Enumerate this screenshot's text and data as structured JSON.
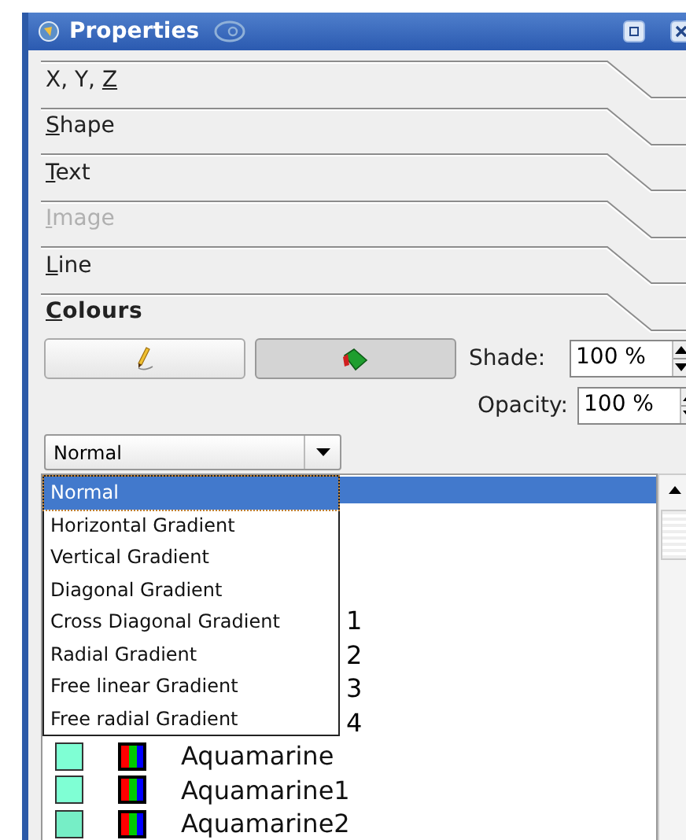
{
  "window": {
    "title": "Properties"
  },
  "sections": [
    {
      "before": "X, Y, ",
      "key": "Z",
      "disabled": false,
      "expanded": false
    },
    {
      "key": "S",
      "after": "hape",
      "disabled": false,
      "expanded": false
    },
    {
      "key": "T",
      "after": "ext",
      "disabled": false,
      "expanded": false
    },
    {
      "key": "I",
      "after": "mage",
      "disabled": true,
      "expanded": false
    },
    {
      "key": "L",
      "after": "ine",
      "disabled": false,
      "expanded": false
    },
    {
      "key": "C",
      "after": "olours",
      "disabled": false,
      "expanded": true
    }
  ],
  "colours": {
    "target_buttons": [
      {
        "kind": "stroke",
        "selected": false
      },
      {
        "kind": "fill",
        "selected": true
      }
    ],
    "shade": {
      "label": "Shade:",
      "value": "100 %"
    },
    "opacity": {
      "label": "Opacity:",
      "value": "100 %"
    },
    "fill_type": {
      "value": "Normal"
    },
    "fill_type_options": [
      {
        "label": "Normal",
        "selected": true
      },
      {
        "label": "Horizontal Gradient",
        "selected": false
      },
      {
        "label": "Vertical Gradient",
        "selected": false
      },
      {
        "label": "Diagonal Gradient",
        "selected": false
      },
      {
        "label": "Cross Diagonal Gradient",
        "selected": false
      },
      {
        "label": "Radial Gradient",
        "selected": false
      },
      {
        "label": "Free linear Gradient",
        "selected": false
      },
      {
        "label": "Free radial Gradient",
        "selected": false
      }
    ],
    "colour_list": [
      {
        "kind": "obscured",
        "selected": true
      },
      {
        "kind": "obscured",
        "text": "1",
        "selected": false
      },
      {
        "kind": "obscured",
        "text": "2",
        "selected": false
      },
      {
        "kind": "obscured",
        "text": "3",
        "selected": false
      },
      {
        "kind": "obscured",
        "text": "4",
        "selected": false
      },
      {
        "kind": "colour",
        "name": "Aquamarine",
        "color": "#7fffd4",
        "selected": false
      },
      {
        "kind": "colour",
        "name": "Aquamarine1",
        "color": "#7fffd4",
        "selected": false
      },
      {
        "kind": "colour",
        "name": "Aquamarine2",
        "color": "#76eec6",
        "selected": false
      }
    ]
  }
}
